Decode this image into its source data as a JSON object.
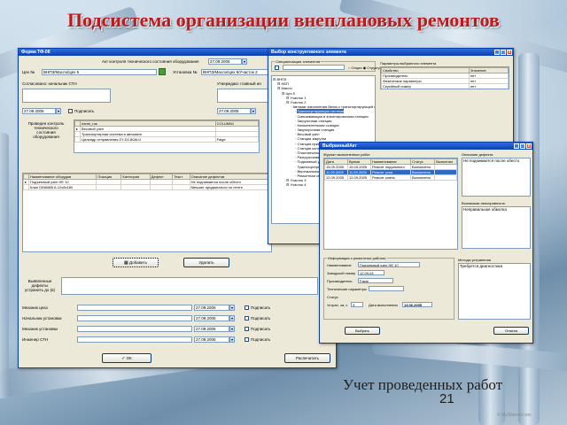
{
  "slide": {
    "title": "Подсистема организации внеплановых ремонтов",
    "caption": "Учет проведенных работ",
    "page_number": "21",
    "watermark": "© MyShared.com"
  },
  "form": {
    "title": "Форма ТФ-08",
    "act_title": "Акт контроля технического состояния оборудования",
    "date1": "27.09.2005",
    "workshop_label": "Цех №",
    "workshop_value": "ВНПЗ/Масло/Цех 5",
    "installation_label": "Установка №",
    "installation_value": "ВНПЗ/Масло/Цех 5/Участок 2",
    "agreed_label": "Согласовано: начальник СТН",
    "approved_label": "Утверждаю: главный ин",
    "date2": "27.09.2005",
    "sign1_label": "Подписать",
    "date3": "27.09.2005",
    "control_label": "Проведен контроль технического состояния оборудования",
    "equip_headers": [
      "name_rus",
      "COLUMN1"
    ],
    "equip_rows": [
      [
        "Весовой узел",
        ""
      ],
      [
        "Транспортерная система в автомате",
        ""
      ],
      [
        "Цилиндр отправления ZY-D2-80ALU",
        "Faige"
      ]
    ],
    "defects_headers": [
      "Наименование оборудов",
      "Позиция",
      "Категория",
      "Дефект",
      "Текст",
      "Описание дефектов"
    ],
    "defects_rows": [
      [
        "Подъемный узел НЕ 10",
        "",
        "",
        "",
        "",
        "Не поднимается после обесто"
      ],
      [
        "Клин DIN6885 A-12x8x180",
        "",
        "",
        "",
        "",
        "Мешает продвигаться по ленте"
      ]
    ],
    "add_button": "Добавить",
    "delete_button": "Удалить",
    "detected_label": "Выявленные дефекты устранить до (в)",
    "mech_workshop": "Механик цеха",
    "head_installation": "Начальник установки",
    "mech_installation": "Механик установки",
    "engineer_stn": "Инженер СТН",
    "sign_dates": [
      "27.09.2005",
      "27.09.2005",
      "27.09.2005",
      "27.09.2005"
    ],
    "sign_label": "Подписать",
    "ok_button": "ОК",
    "print_button": "Распечатать"
  },
  "select_window": {
    "title": "Выбор конструктивного элемента",
    "filter_label": "Специализация элементов",
    "radio1": "Опции",
    "radio2": "Структура",
    "params_title": "Параметры выбранного элемента",
    "params_headers": [
      "Свойство",
      "Значение"
    ],
    "params_rows": [
      [
        "Производитель",
        "нет"
      ],
      [
        "Физические параметры",
        "нет"
      ],
      [
        "Серийный номер",
        "нет"
      ]
    ],
    "tree": [
      "ВНПЗ",
      "НБП",
      "Масло",
      "Цех 5",
      "Участок 1",
      "Участок 2",
      "Автомат наполнения банок с транспортирующей лентой",
      "Транспортирующая система",
      "Смешивающая и этикетировочная станция",
      "Загрузочная станция",
      "Наполнительная станция",
      "Закупорочная станция",
      "Весовой узел",
      "Станция закрутки",
      "Станция приемной конвейер",
      "Станция контроля веса",
      "Пластинчатый транспортер",
      "Разгрузочная станция",
      "Подъемный узел",
      "Транспортерная система",
      "Вертикальный узел",
      "Ремонтная станция",
      "Участок 3",
      "Участок 4"
    ]
  },
  "repair_window": {
    "title": "ВыбранныйАкт",
    "works_title": "Журнал выполненных работ",
    "works_headers": [
      "Дата",
      "Время",
      "Наименование",
      "Статус",
      "Выполнил"
    ],
    "works_rows": [
      [
        "15.09.2005",
        "15.09.2005",
        "Ремонт подъемного",
        "Выполнено",
        ""
      ],
      [
        "11.09.2005",
        "11.09.2005",
        "Ремонт узла",
        "Выполнено",
        ""
      ],
      [
        "12.09.2005",
        "12.09.2005",
        "Ремонт клина",
        "Выполнено",
        ""
      ]
    ],
    "defect_desc_title": "Описание дефекта",
    "defect_desc_text": "Не поднимается после обесто",
    "cause_title": "Возникшая неисправность",
    "cause_text": "Неправильная обмотка",
    "info_title": "Информация о ремонтных работах",
    "name_label": "Наименование",
    "name_value": "Подъемный узел НЕ 10",
    "plant_label": "Заводской номер",
    "plant_value": "12.09.04",
    "maker_label": "Производитель",
    "maker_value": "Faige",
    "params_label": "Технические параметры",
    "params_value": "",
    "status_label": "Статус",
    "period_label": "Устран. за, ч",
    "period_value": "3",
    "done_label": "Дата выполнения",
    "done_value": "13.06.2005",
    "methods_title": "Методы устранения",
    "methods_text": "Требуется диагностика",
    "select_button": "Выбрать",
    "cancel_button": "Отмена"
  },
  "colors": {
    "title_red": "#c0181c",
    "titlebar_blue": "#0a3fae",
    "selection_blue": "#316ac5",
    "window_face": "#ece9d8"
  }
}
